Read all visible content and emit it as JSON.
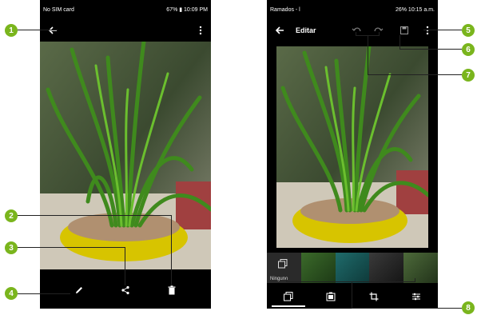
{
  "left_phone": {
    "status_left": "No SIM card",
    "status_right": "67% ▮ 10:09 PM"
  },
  "right_phone": {
    "status_left": "Ramados - l",
    "status_right": "26% 10:15 a.m.",
    "title": "Editar",
    "filter_label": "Ninguno"
  },
  "callouts": [
    "1",
    "2",
    "3",
    "4",
    "5",
    "6",
    "7",
    "8"
  ],
  "icons": {
    "back": "back-arrow-icon",
    "more": "more-vert-icon",
    "edit": "pencil-icon",
    "share": "share-icon",
    "delete": "trash-icon",
    "undo": "undo-icon",
    "redo": "redo-icon",
    "save": "save-icon",
    "filters": "filters-icon",
    "frames": "frames-icon",
    "crop": "crop-icon",
    "adjust": "adjust-icon"
  },
  "colors": {
    "callout": "#7ab51d",
    "background": "#000000"
  }
}
